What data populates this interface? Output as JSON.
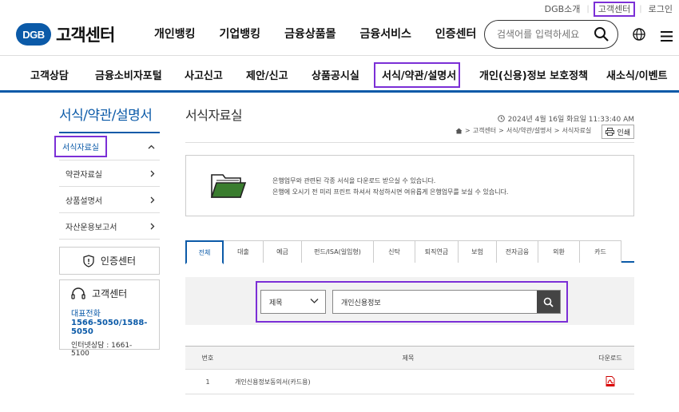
{
  "util": {
    "about": "DGB소개",
    "cs_center": "고객센터",
    "login": "로그인"
  },
  "header": {
    "logo_badge": "DGB",
    "logo_text": "고객센터",
    "gnb": [
      "개인뱅킹",
      "기업뱅킹",
      "금융상품몰",
      "금융서비스",
      "인증센터"
    ],
    "search_placeholder": "검색어를 입력하세요"
  },
  "subnav": [
    "고객상담",
    "금융소비자포털",
    "사고신고",
    "제안/신고",
    "상품공시실",
    "서식/약관/설명서",
    "개인(신용)정보 보호정책",
    "새소식/이벤트"
  ],
  "lnb": {
    "title": "서식/약관/설명서",
    "items": [
      "서식자료실",
      "약관자료실",
      "상품설명서",
      "자산운용보고서"
    ]
  },
  "auth_center": "인증센터",
  "cs": {
    "title": "고객센터",
    "phone_label": "대표전화",
    "phone": "1566-5050/1588-5050",
    "chat": "인터넷상담 : 1661-5100"
  },
  "page": {
    "title": "서식자료실",
    "datetime": "2024년 4월 16일 화요일 11:33:40 AM",
    "breadcrumb": [
      "고객센터",
      "서식/약관/설명서",
      "서식자료실"
    ],
    "print": "인쇄"
  },
  "info": {
    "line1": "은행업무와 관련된 각종 서식을 다운로드 받으실 수 있습니다.",
    "line2": "은행에 오시기 전 미리 프린트 하셔서 작성하시면 여유롭게 은행업무를 보실 수 있습니다."
  },
  "tabs": [
    "전체",
    "대출",
    "예금",
    "펀드/ISA(일임형)",
    "신탁",
    "퇴직연금",
    "보험",
    "전자금융",
    "외환",
    "카드"
  ],
  "search": {
    "category": "제목",
    "query": "개인신용정보"
  },
  "table": {
    "headers": {
      "no": "번호",
      "title": "제목",
      "download": "다운로드"
    },
    "rows": [
      {
        "no": "1",
        "title": "개인신용정보동의서(카드용)"
      }
    ]
  },
  "colors": {
    "brand": "#0b5aa8",
    "highlight": "#7b2fd6"
  }
}
